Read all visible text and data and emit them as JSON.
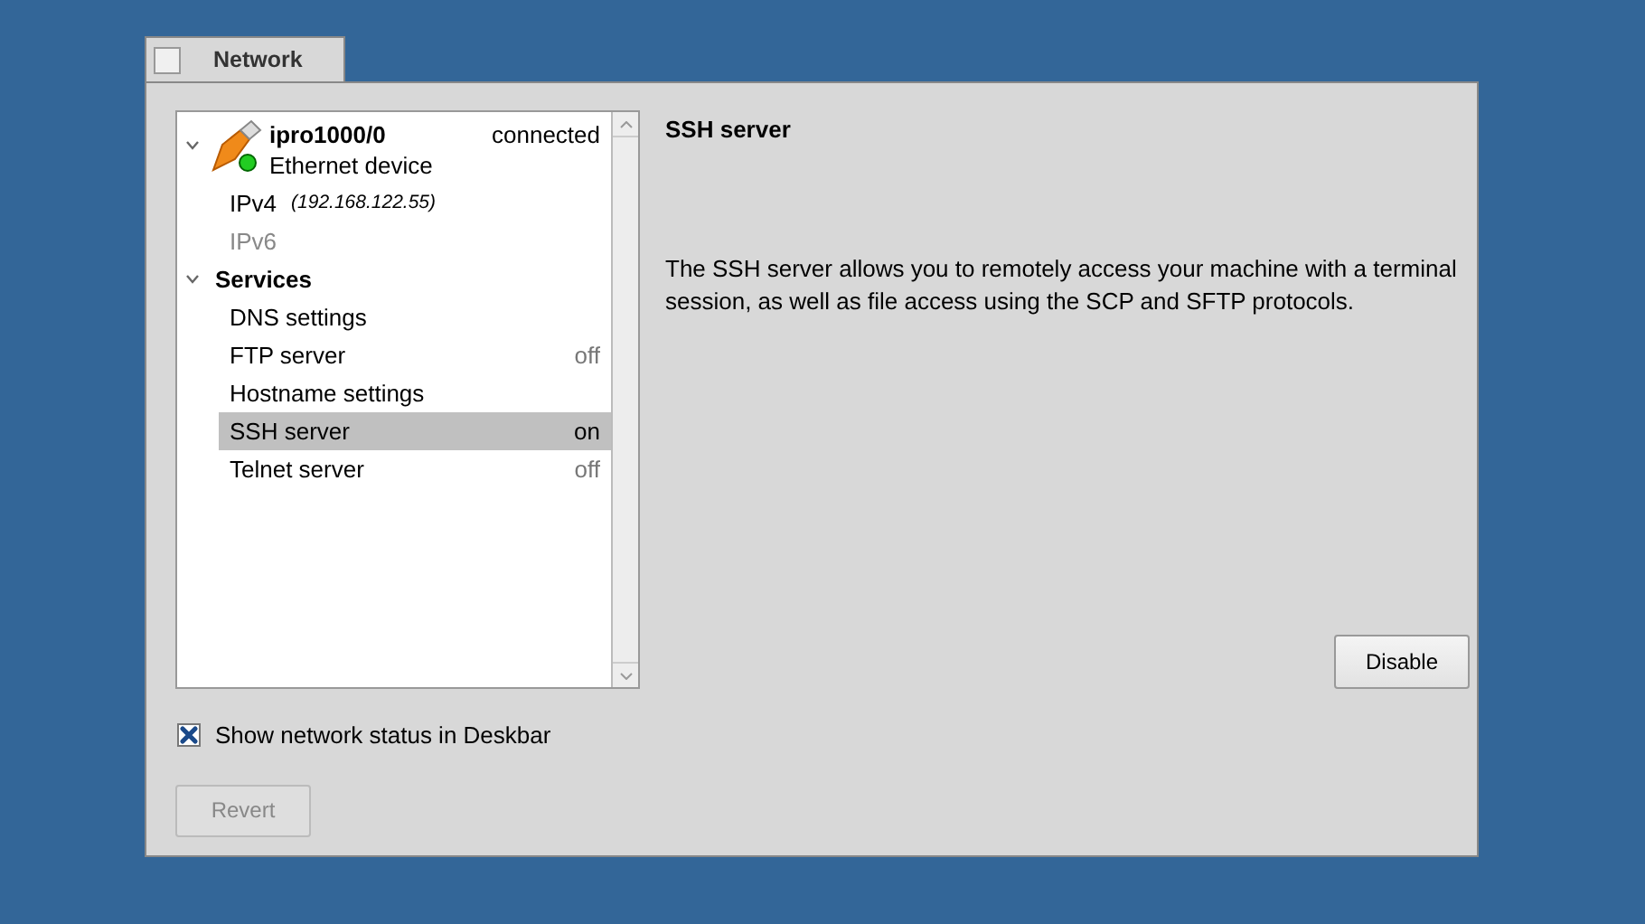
{
  "window": {
    "title": "Network"
  },
  "tree": [
    {
      "kind": "device",
      "name": "ipro1000/0",
      "subtitle": "Ethernet device",
      "status": "connected",
      "expanded": true,
      "children": [
        {
          "label": "IPv4",
          "detail": "(192.168.122.55)",
          "disabled": false,
          "selected": false
        },
        {
          "label": "IPv6",
          "disabled": true,
          "selected": false
        }
      ]
    },
    {
      "kind": "group",
      "label": "Services",
      "expanded": true,
      "children": [
        {
          "label": "DNS settings",
          "disabled": false,
          "selected": false
        },
        {
          "label": "FTP server",
          "value": "off",
          "disabled": false,
          "selected": false
        },
        {
          "label": "Hostname settings",
          "disabled": false,
          "selected": false
        },
        {
          "label": "SSH server",
          "value": "on",
          "disabled": false,
          "selected": true
        },
        {
          "label": "Telnet server",
          "value": "off",
          "disabled": false,
          "selected": false
        }
      ]
    }
  ],
  "panel": {
    "title": "SSH server",
    "description": "The SSH server allows you to remotely access your machine with a terminal session, as well as file access using the SCP and SFTP protocols.",
    "button": {
      "label": "Disable",
      "disabled": false
    }
  },
  "deskbar_checkbox": {
    "label": "Show network status in Deskbar",
    "checked": true
  },
  "revert_button": {
    "label": "Revert",
    "disabled": true
  }
}
